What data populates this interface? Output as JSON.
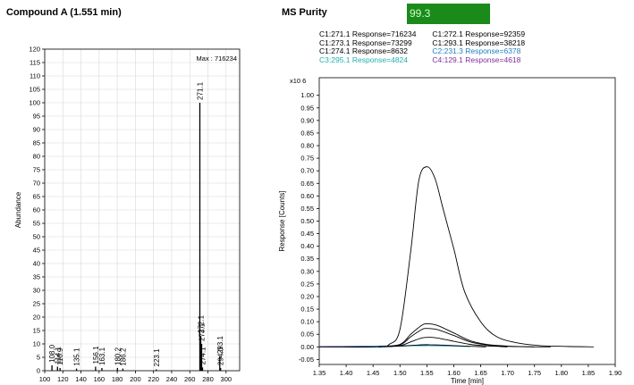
{
  "header": {
    "left_title": "Compound A (1.551 min)",
    "right_title": "MS Purity",
    "purity_value": "99.3",
    "purity_color": "#1a8a1a"
  },
  "legend": [
    {
      "text": "C1:271.1 Response=716234",
      "color": "#000000"
    },
    {
      "text": "C1:272.1 Response=92359",
      "color": "#000000"
    },
    {
      "text": "C1:273.1 Response=73299",
      "color": "#000000"
    },
    {
      "text": "C1:293.1 Response=38218",
      "color": "#000000"
    },
    {
      "text": "C1:274.1 Response=8632",
      "color": "#000000"
    },
    {
      "text": "C2:231.3 Response=6378",
      "color": "#1f7fc0"
    },
    {
      "text": "C3:295.1 Response=4824",
      "color": "#20b0b0"
    },
    {
      "text": "C4:129.1 Response=4618",
      "color": "#8030a0"
    }
  ],
  "chart_data": [
    {
      "type": "bar",
      "name": "mass-spectrum",
      "ylabel": "Abundance",
      "annotation": "Max : 716234",
      "xlim": [
        100,
        315
      ],
      "ylim": [
        0,
        120
      ],
      "xticks": [
        "100",
        "120",
        "140",
        "160",
        "180",
        "200",
        "220",
        "240",
        "260",
        "280",
        "300"
      ],
      "yticks": [
        "0",
        "5",
        "10",
        "15",
        "20",
        "25",
        "30",
        "35",
        "40",
        "45",
        "50",
        "55",
        "60",
        "65",
        "70",
        "75",
        "80",
        "85",
        "90",
        "95",
        "100",
        "105",
        "110",
        "115",
        "120"
      ],
      "peaks": [
        {
          "label": "108.0",
          "x": 108.0,
          "y": 2
        },
        {
          "label": "114.1",
          "x": 114.1,
          "y": 1.5
        },
        {
          "label": "116.9",
          "x": 116.9,
          "y": 1
        },
        {
          "label": "135.1",
          "x": 135.1,
          "y": 0.8
        },
        {
          "label": "156.1",
          "x": 156.1,
          "y": 1.5
        },
        {
          "label": "163.1",
          "x": 163.1,
          "y": 1
        },
        {
          "label": "180.2",
          "x": 180.2,
          "y": 1
        },
        {
          "label": "186.2",
          "x": 186.2,
          "y": 0.8
        },
        {
          "label": "223.1",
          "x": 223.1,
          "y": 0.5
        },
        {
          "label": "271.1",
          "x": 271.1,
          "y": 100
        },
        {
          "label": "272.1",
          "x": 272.1,
          "y": 13
        },
        {
          "label": "273.1",
          "x": 273.1,
          "y": 10
        },
        {
          "label": "274.1",
          "x": 274.1,
          "y": 1.2
        },
        {
          "label": "293.1",
          "x": 293.1,
          "y": 5.3
        },
        {
          "label": "294.0",
          "x": 294.0,
          "y": 1
        }
      ]
    },
    {
      "type": "line",
      "name": "ion-chromatograms",
      "xlabel": "Time [min]",
      "ylabel": "Response [Counts]",
      "yscale_label": "x10 6",
      "xlim": [
        1.35,
        1.9
      ],
      "ylim": [
        -0.07,
        1.07
      ],
      "xticks": [
        "1.35",
        "1.40",
        "1.45",
        "1.50",
        "1.55",
        "1.60",
        "1.65",
        "1.70",
        "1.75",
        "1.80",
        "1.85",
        "1.90"
      ],
      "yticks": [
        "-0.05",
        "0.00",
        "0.05",
        "0.10",
        "0.15",
        "0.20",
        "0.25",
        "0.30",
        "0.35",
        "0.40",
        "0.45",
        "0.50",
        "0.55",
        "0.60",
        "0.65",
        "0.70",
        "0.75",
        "0.80",
        "0.85",
        "0.90",
        "0.95",
        "1.00"
      ],
      "series": [
        {
          "color": "#000000",
          "x": [
            1.35,
            1.46,
            1.48,
            1.5,
            1.52,
            1.535,
            1.55,
            1.565,
            1.58,
            1.6,
            1.62,
            1.65,
            1.68,
            1.72,
            1.76,
            1.8,
            1.86
          ],
          "y": [
            0,
            0,
            0.01,
            0.07,
            0.38,
            0.66,
            0.716,
            0.67,
            0.55,
            0.39,
            0.22,
            0.1,
            0.04,
            0.015,
            0.005,
            0.002,
            0
          ]
        },
        {
          "color": "#000000",
          "x": [
            1.46,
            1.5,
            1.52,
            1.54,
            1.55,
            1.57,
            1.6,
            1.63,
            1.66,
            1.7,
            1.75,
            1.78
          ],
          "y": [
            0,
            0.01,
            0.05,
            0.085,
            0.092,
            0.085,
            0.055,
            0.025,
            0.01,
            0.003,
            0,
            0
          ]
        },
        {
          "color": "#000000",
          "x": [
            1.46,
            1.5,
            1.52,
            1.54,
            1.55,
            1.57,
            1.6,
            1.63,
            1.66,
            1.7,
            1.75
          ],
          "y": [
            0,
            0.008,
            0.04,
            0.068,
            0.073,
            0.068,
            0.045,
            0.02,
            0.008,
            0.002,
            0
          ]
        },
        {
          "color": "#000000",
          "x": [
            1.46,
            1.5,
            1.52,
            1.54,
            1.555,
            1.57,
            1.6,
            1.63,
            1.66,
            1.7
          ],
          "y": [
            0,
            0.005,
            0.02,
            0.035,
            0.038,
            0.035,
            0.022,
            0.01,
            0.004,
            0
          ]
        },
        {
          "color": "#000000",
          "x": [
            1.47,
            1.51,
            1.54,
            1.555,
            1.58,
            1.62,
            1.66
          ],
          "y": [
            0,
            0.004,
            0.008,
            0.0086,
            0.007,
            0.003,
            0
          ]
        },
        {
          "color": "#1f7fc0",
          "x": [
            1.35,
            1.45,
            1.5,
            1.55,
            1.6,
            1.63
          ],
          "y": [
            0,
            0.002,
            0.005,
            0.006,
            0.004,
            0.002
          ]
        },
        {
          "color": "#20b0b0",
          "x": [
            1.43,
            1.5,
            1.55,
            1.6,
            1.63
          ],
          "y": [
            0.001,
            0.004,
            0.0048,
            0.003,
            0.001
          ]
        },
        {
          "color": "#8030a0",
          "x": [
            1.35,
            1.4,
            1.45,
            1.5,
            1.55
          ],
          "y": [
            0.001,
            0.002,
            0.003,
            0.004,
            0.0046
          ]
        }
      ]
    }
  ]
}
